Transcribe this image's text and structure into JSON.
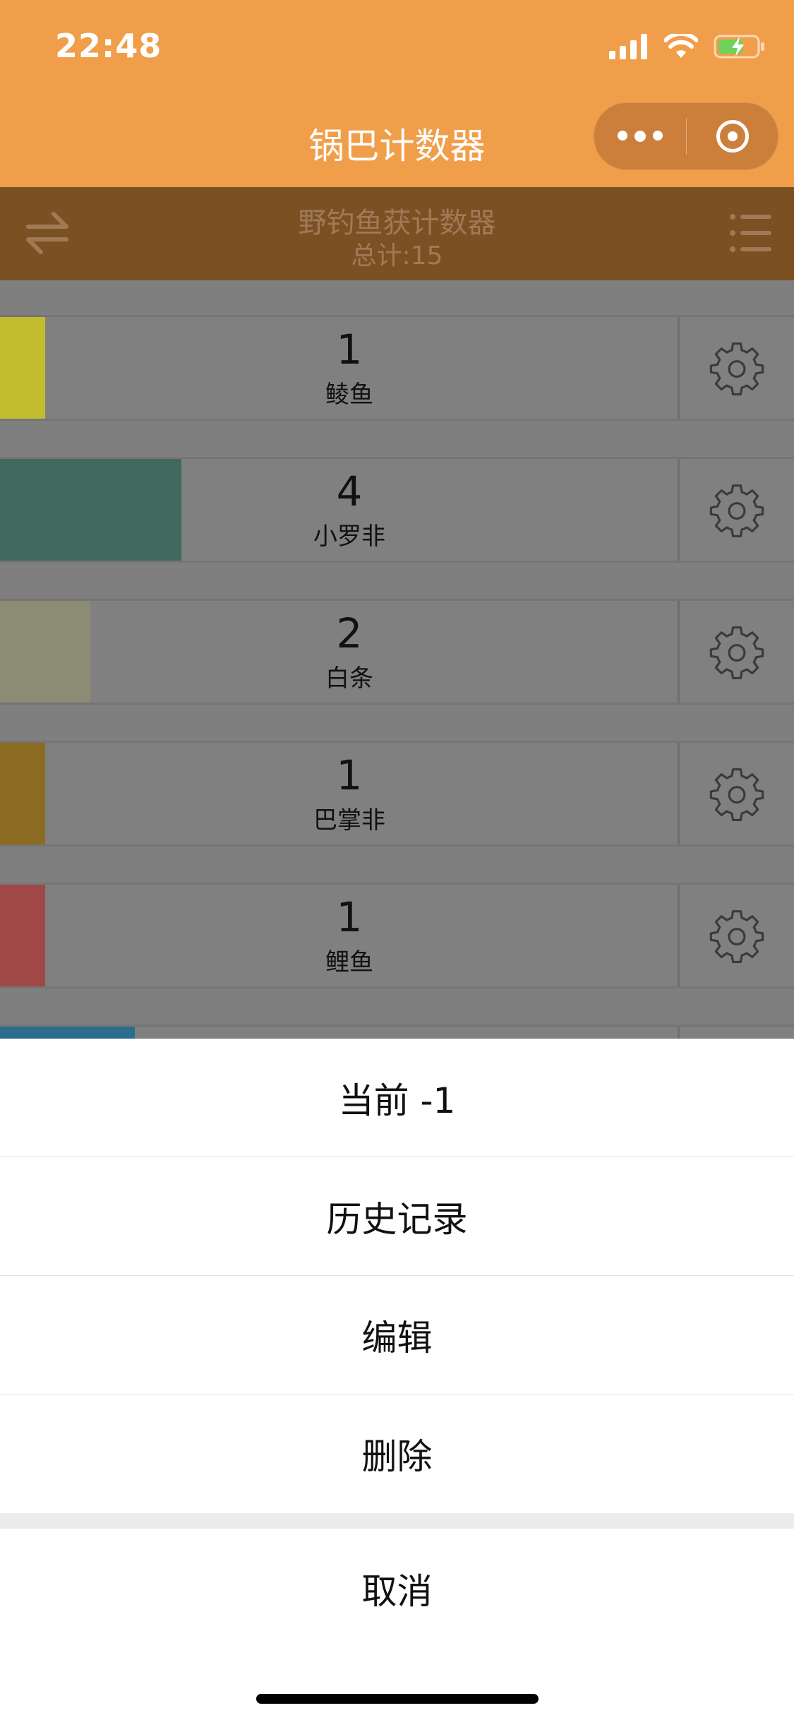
{
  "status_bar": {
    "time": "22:48"
  },
  "nav": {
    "title": "锅巴计数器"
  },
  "header": {
    "title": "野钓鱼获计数器",
    "total": "总计:15"
  },
  "counters": [
    {
      "count": "1",
      "name": "鲮鱼",
      "color": "#c1bc2e",
      "fill": 0.057
    },
    {
      "count": "4",
      "name": "小罗非",
      "color": "#42695d",
      "fill": 0.228
    },
    {
      "count": "2",
      "name": "白条",
      "color": "#8c8b74",
      "fill": 0.114
    },
    {
      "count": "1",
      "name": "巴掌非",
      "color": "#8b6a22",
      "fill": 0.057
    },
    {
      "count": "1",
      "name": "鲤鱼",
      "color": "#a04848",
      "fill": 0.057
    },
    {
      "count": "",
      "name": "",
      "color": "#2b6d8d",
      "fill": 0.17
    }
  ],
  "action_sheet": {
    "items": [
      "当前 -1",
      "历史记录",
      "编辑",
      "删除"
    ],
    "cancel": "取消"
  }
}
